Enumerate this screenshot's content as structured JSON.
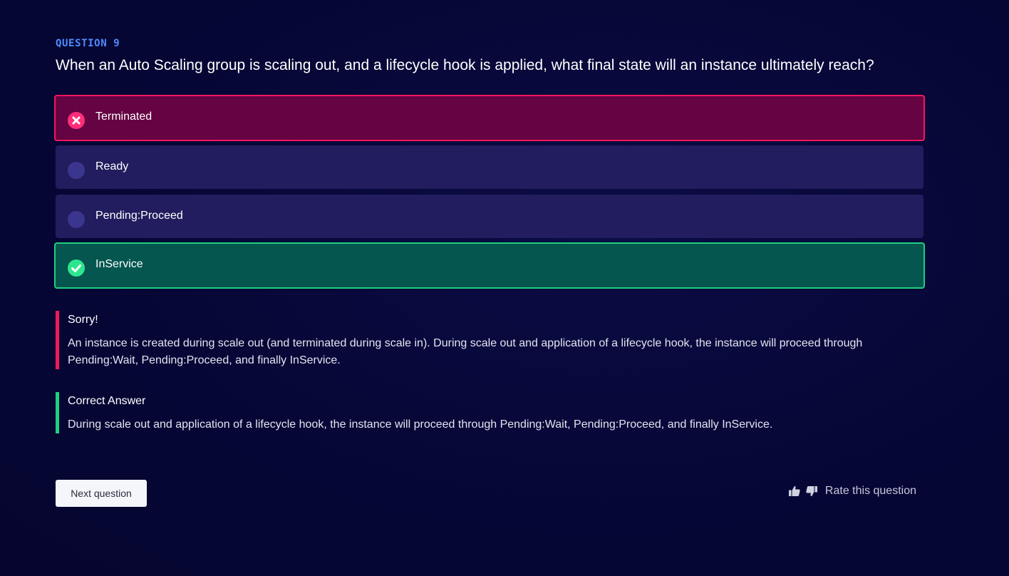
{
  "question": {
    "number_label": "QUESTION 9",
    "text": "When an Auto Scaling group is scaling out, and a lifecycle hook is applied, what final state will an instance ultimately reach?"
  },
  "options": [
    {
      "label": "Terminated",
      "state": "selected-wrong",
      "icon": "x-circle-icon"
    },
    {
      "label": "Ready",
      "state": "unselected",
      "icon": "radio-icon"
    },
    {
      "label": "Pending:Proceed",
      "state": "unselected",
      "icon": "radio-icon"
    },
    {
      "label": "InService",
      "state": "correct",
      "icon": "check-circle-icon"
    }
  ],
  "feedback": {
    "sorry_title": "Sorry!",
    "sorry_body": "An instance is created during scale out (and terminated during scale in). During scale out and application of a lifecycle hook, the instance will proceed through Pending:Wait, Pending:Proceed, and finally InService.",
    "correct_title": "Correct Answer",
    "correct_body": "During scale out and application of a lifecycle hook, the instance will proceed through Pending:Wait, Pending:Proceed, and finally InService."
  },
  "actions": {
    "next_label": "Next question",
    "rate_label": "Rate this question"
  },
  "colors": {
    "background": "#070738",
    "accent_blue": "#4e8cff",
    "wrong": "#f4175c",
    "wrong_bg": "#650343",
    "correct": "#1fd07e",
    "correct_bg": "#04564f",
    "option_bg": "#221d5e"
  }
}
